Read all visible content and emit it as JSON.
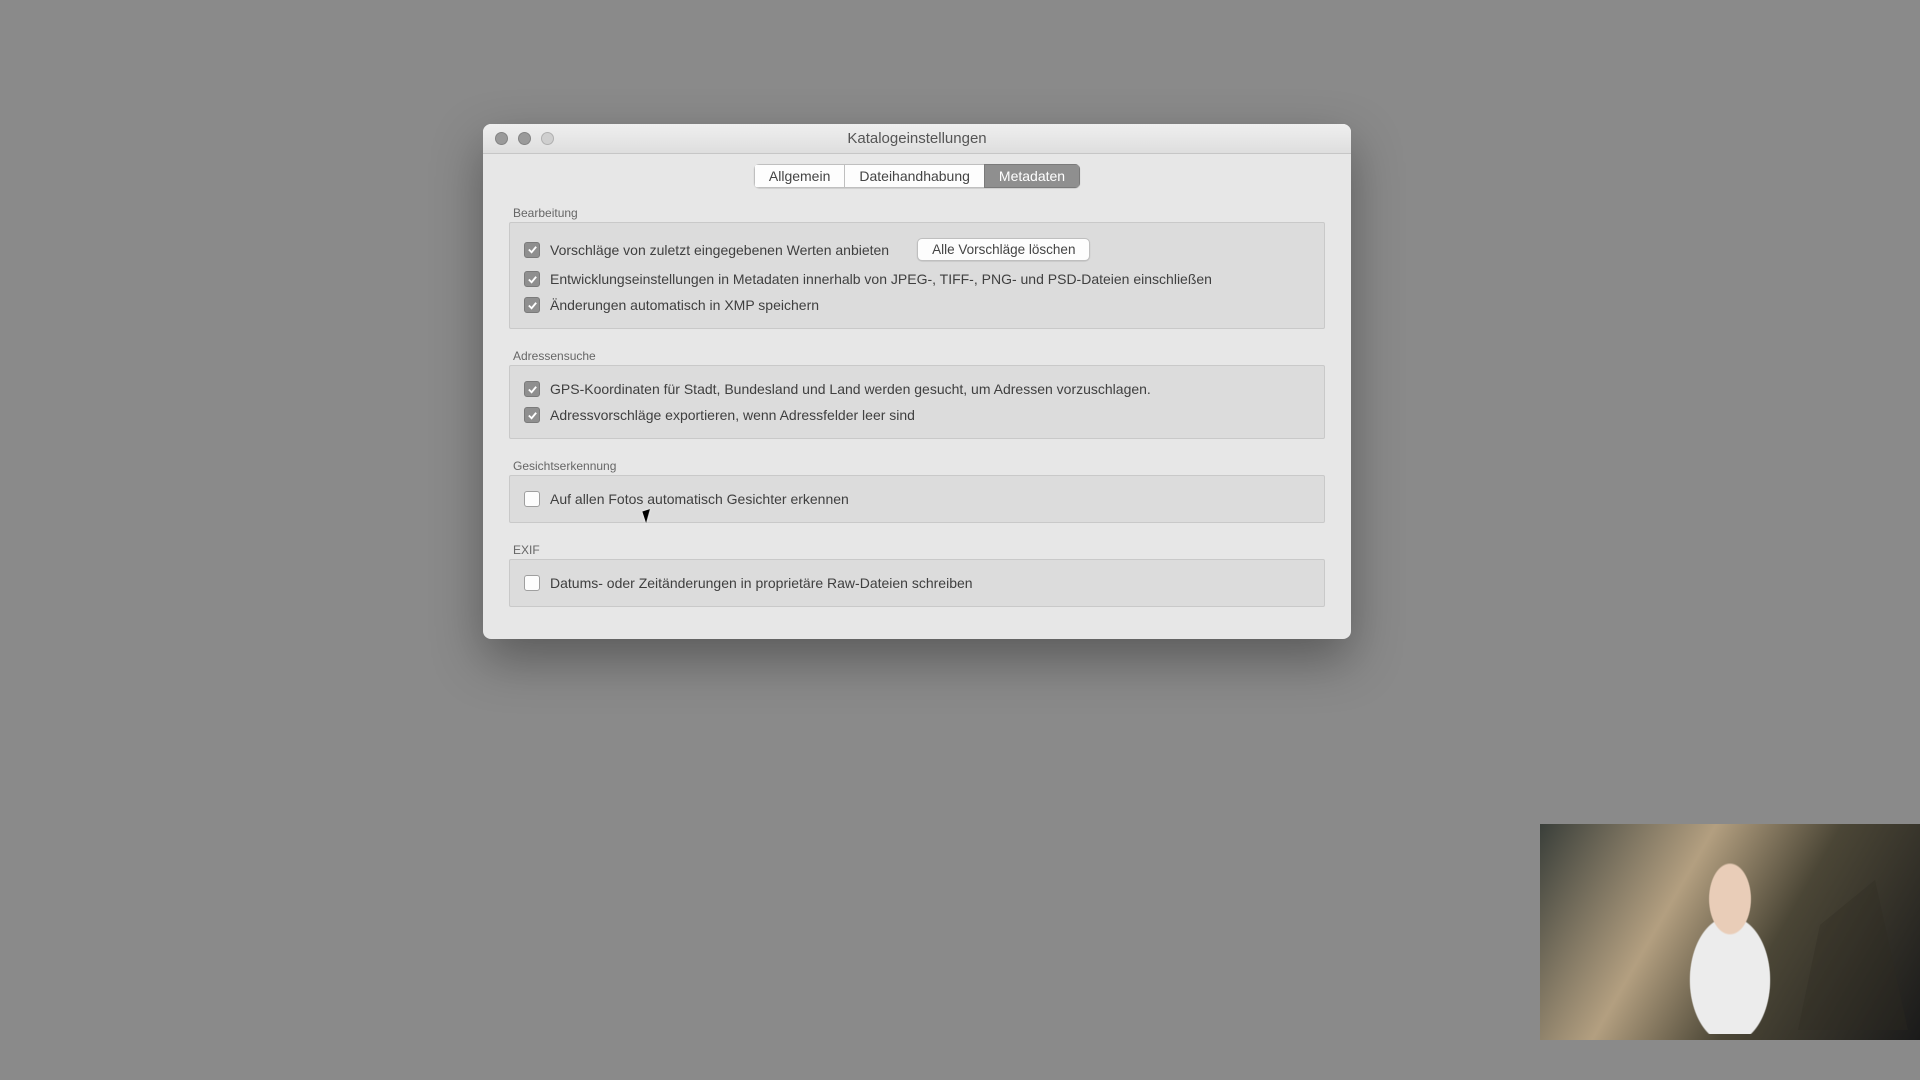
{
  "window": {
    "title": "Katalogeinstellungen"
  },
  "tabs": {
    "general": "Allgemein",
    "filehandling": "Dateihandhabung",
    "metadata": "Metadaten",
    "active": "metadata"
  },
  "groups": {
    "editing": {
      "label": "Bearbeitung",
      "items": {
        "suggest_recent": {
          "checked": true,
          "label": "Vorschläge von zuletzt eingegebenen Werten anbieten"
        },
        "clear_button": "Alle Vorschläge löschen",
        "include_dev": {
          "checked": true,
          "label": "Entwicklungseinstellungen in Metadaten innerhalb von JPEG-, TIFF-, PNG- und PSD-Dateien einschließen"
        },
        "save_xmp": {
          "checked": true,
          "label": "Änderungen automatisch in XMP speichern"
        }
      }
    },
    "address": {
      "label": "Adressensuche",
      "items": {
        "gps_lookup": {
          "checked": true,
          "label": "GPS-Koordinaten für Stadt, Bundesland und Land werden gesucht, um Adressen vorzuschlagen."
        },
        "export_address": {
          "checked": true,
          "label": "Adressvorschläge exportieren, wenn Adressfelder leer sind"
        }
      }
    },
    "face": {
      "label": "Gesichtserkennung",
      "items": {
        "auto_face": {
          "checked": false,
          "label": "Auf allen Fotos automatisch Gesichter erkennen"
        }
      }
    },
    "exif": {
      "label": "EXIF",
      "items": {
        "write_raw": {
          "checked": false,
          "label": "Datums- oder Zeitänderungen in proprietäre Raw-Dateien schreiben"
        }
      }
    }
  }
}
